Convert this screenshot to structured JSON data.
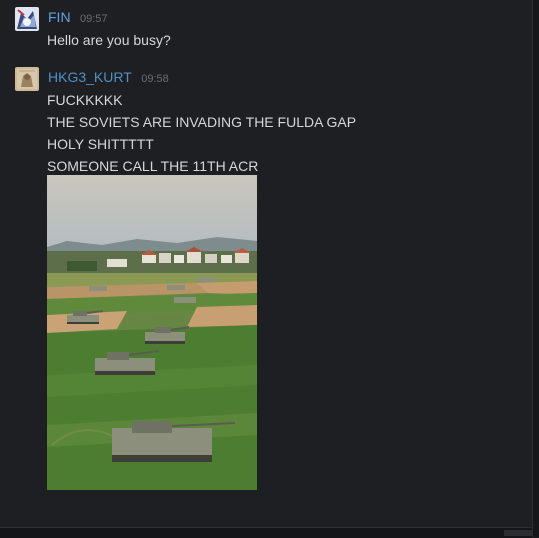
{
  "messages": [
    {
      "author": "FIN",
      "time": "09:57",
      "lines": [
        "Hello are you busy?"
      ]
    },
    {
      "author": "HKG3_KURT",
      "time": "09:58",
      "lines": [
        "FUCKKKKK",
        "THE SOVIETS ARE INVADING THE FULDA GAP",
        "HOLY SHITTTTT",
        "SOMEONE CALL THE 11TH ACR"
      ],
      "attachment": "tank-formation-photo"
    }
  ],
  "colors": {
    "background": "#1e1f23",
    "author_fin": "#5ea3e3",
    "author_kurt": "#4f91c8",
    "message_text": "#d6d7d9",
    "timestamp": "#6a6d73"
  }
}
